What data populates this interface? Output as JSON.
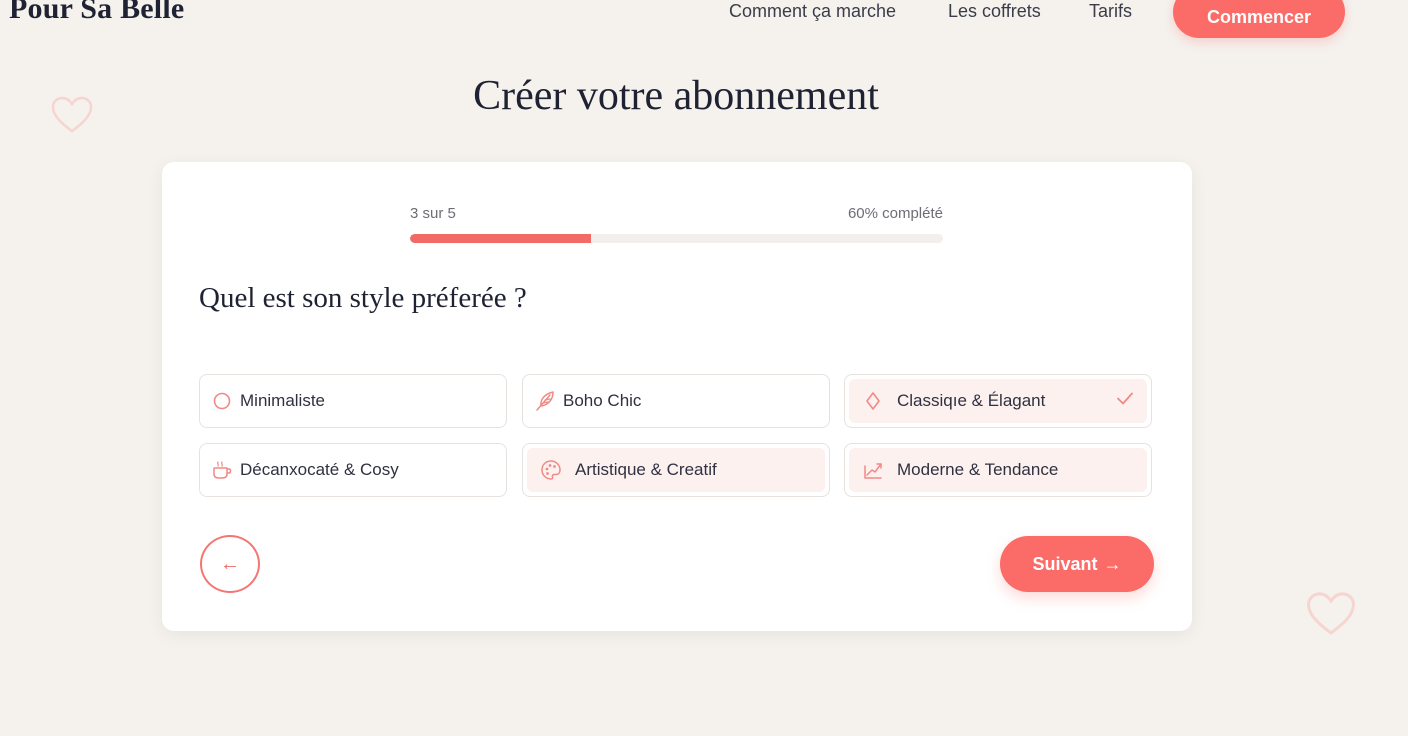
{
  "brand": {
    "name": "Pour Sa Belle"
  },
  "nav": {
    "links": [
      {
        "label": "Comment ça marche"
      },
      {
        "label": "Les coffrets"
      },
      {
        "label": "Tarifs"
      }
    ],
    "cta_label": "Commencer"
  },
  "page": {
    "title": "Créer votre abonnement"
  },
  "progress": {
    "step_label": "3 sur 5",
    "percent_label": "60% complété",
    "fill_fraction": 0.34
  },
  "question": {
    "text": "Quel est son style préferée ?"
  },
  "options": [
    {
      "label": "Minimaliste",
      "icon": "circle-icon",
      "selected": false
    },
    {
      "label": "Boho Chic",
      "icon": "feather-icon",
      "selected": false
    },
    {
      "label": "Classiqıe & Élagant",
      "icon": "diamond-icon",
      "selected": true
    },
    {
      "label": "Décanxocaté & Cosy",
      "icon": "cup-icon",
      "selected": false
    },
    {
      "label": "Artistique & Creatif",
      "icon": "palette-icon",
      "selected": false
    },
    {
      "label": "Moderne & Tendance",
      "icon": "trend-icon",
      "selected": false
    }
  ],
  "buttons": {
    "back_symbol": "←",
    "next_label": "Suivant",
    "next_arrow": "→"
  },
  "colors": {
    "accent": "#fb6b67",
    "background": "#f5f1ed",
    "card": "#ffffff",
    "selected_tint": "#fdf1f0"
  }
}
